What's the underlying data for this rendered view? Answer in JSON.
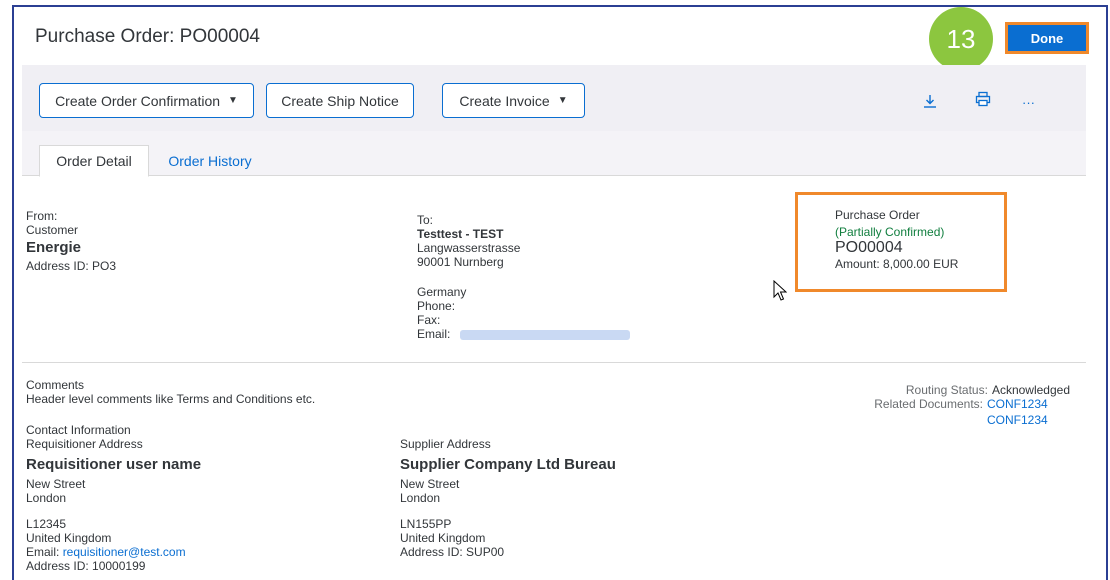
{
  "header": {
    "title": "Purchase Order: PO00004",
    "step_number": "13",
    "done_label": "Done"
  },
  "toolbar": {
    "create_order_confirmation": "Create Order Confirmation",
    "create_ship_notice": "Create Ship Notice",
    "create_invoice": "Create Invoice",
    "download_icon": "download-icon",
    "print_icon": "print-icon",
    "more_icon": "more-icon",
    "more_glyph": "···"
  },
  "tabs": [
    {
      "label": "Order Detail",
      "active": true
    },
    {
      "label": "Order History",
      "active": false
    }
  ],
  "from": {
    "label": "From:",
    "role": "Customer",
    "name": "Energie",
    "address_id": "Address ID:  PO3"
  },
  "to": {
    "label": "To:",
    "name": "Testtest - TEST",
    "street": "Langwasserstrasse",
    "city": "90001 Nurnberg",
    "country": "Germany",
    "phone": "Phone:",
    "fax": "Fax:",
    "email": "Email:"
  },
  "purchase_order": {
    "heading": "Purchase Order",
    "status": "(Partially Confirmed)",
    "number": "PO00004",
    "amount": "Amount: 8,000.00 EUR"
  },
  "comments": {
    "heading": "Comments",
    "text": "Header level comments like Terms and Conditions etc."
  },
  "routing": {
    "status_label": "Routing Status:",
    "status_value": "Acknowledged",
    "related_label": "Related Documents:",
    "related_docs": [
      "CONF1234",
      "CONF1234"
    ]
  },
  "contact": {
    "heading": "Contact Information",
    "requisitioner": {
      "label": "Requisitioner Address",
      "name": "Requisitioner user name",
      "street": "New Street",
      "city": "London",
      "postcode": "L12345",
      "country": "United Kingdom",
      "email_label": "Email:",
      "email": "requisitioner@test.com",
      "address_id": "Address ID:  10000199"
    },
    "supplier": {
      "label": "Supplier Address",
      "name": "Supplier Company Ltd Bureau",
      "street": "New Street",
      "city": "London",
      "postcode": "LN155PP",
      "country": "United Kingdom",
      "address_id": "Address ID:  SUP00"
    }
  },
  "colors": {
    "accent": "#0a6ed1",
    "highlight": "#f0892b",
    "badge": "#8cc63f",
    "status_green": "#107e3e",
    "frame": "#2b3f93"
  }
}
